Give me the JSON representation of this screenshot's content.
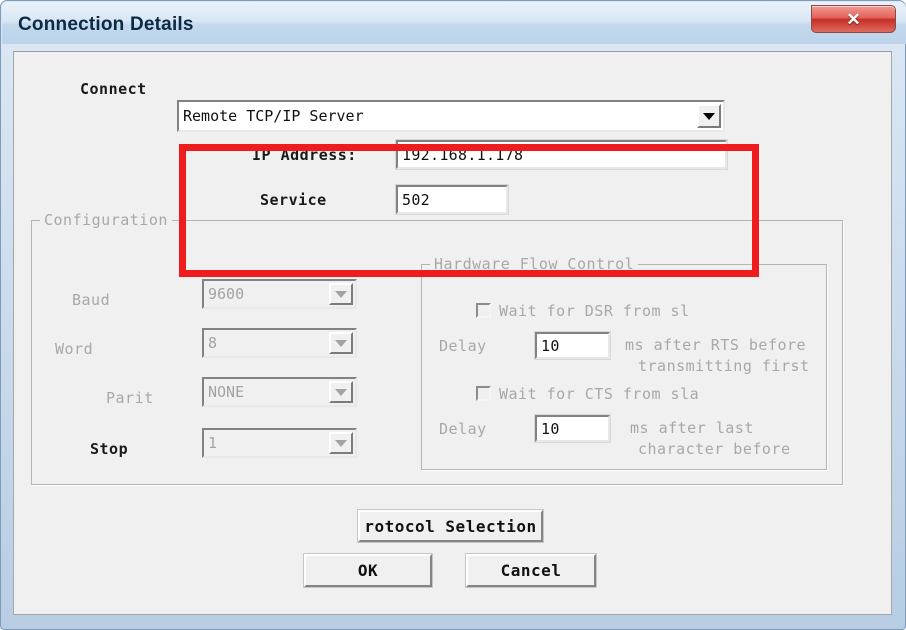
{
  "window": {
    "title": "Connection Details",
    "close_glyph": "✕",
    "accent_highlight_color": "#ee1c1c",
    "titlebar_color": "#bcd3ea",
    "close_button_color": "#c32f26"
  },
  "connect": {
    "label": "Connect",
    "mode_value": "Remote TCP/IP Server",
    "ip_label": "IP Address:",
    "ip_value": "192.168.1.178",
    "service_label": "Service",
    "service_value": "502"
  },
  "configuration": {
    "title": "Configuration",
    "rows": [
      {
        "label": "Baud",
        "value": "9600",
        "disabled": true
      },
      {
        "label": "Word",
        "value": "8",
        "disabled": true
      },
      {
        "label": "Parit",
        "value": "NONE",
        "disabled": true
      },
      {
        "label": "Stop",
        "value": "1",
        "disabled": true
      }
    ]
  },
  "hardware_flow_control": {
    "title": "Hardware Flow Control",
    "dsr_checkbox_label": "Wait for DSR from sl",
    "dsr_checked": false,
    "dsr_delay_label": "Delay",
    "dsr_delay_value": "10",
    "dsr_delay_suffix_line1": "ms after RTS before",
    "dsr_delay_suffix_line2": "transmitting first",
    "cts_checkbox_label": "Wait for CTS from sla",
    "cts_checked": false,
    "cts_delay_label": "Delay",
    "cts_delay_value": "10",
    "cts_delay_suffix_line1": "ms after last",
    "cts_delay_suffix_line2": "character before"
  },
  "buttons": {
    "protocol_selection": "rotocol Selection",
    "ok": "OK",
    "cancel": "Cancel"
  }
}
